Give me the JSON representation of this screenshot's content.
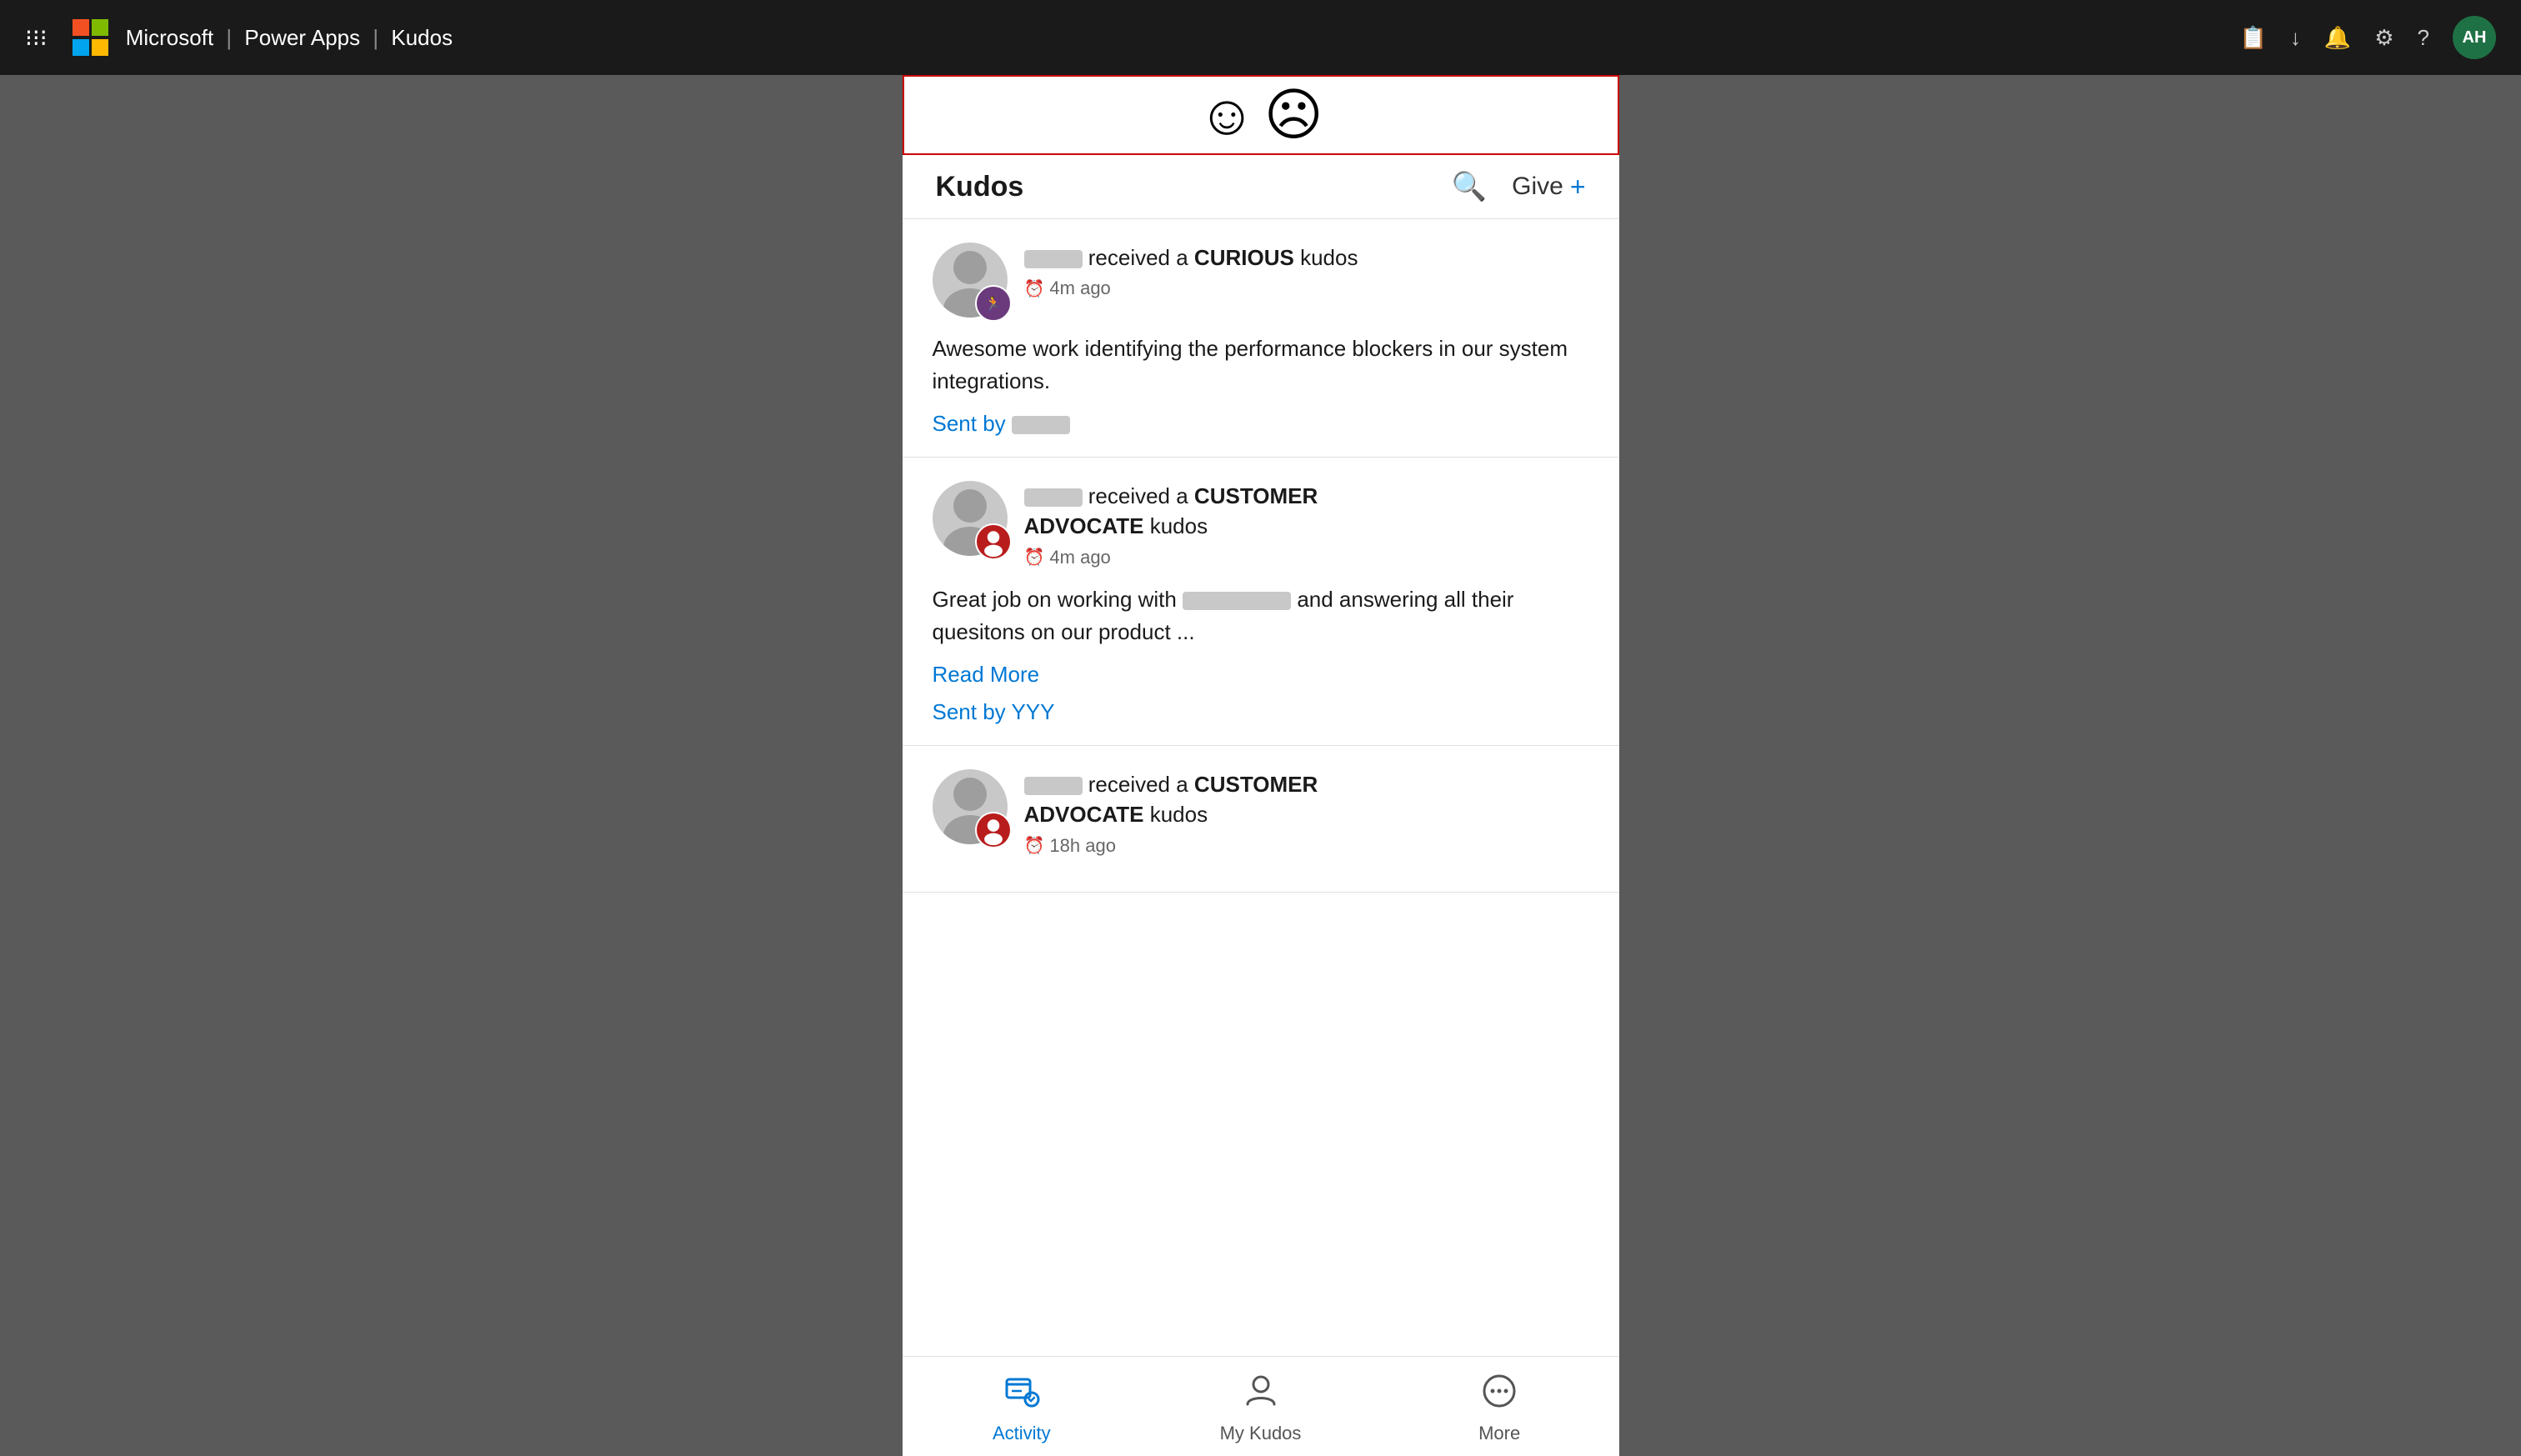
{
  "topbar": {
    "app_name": "Power Apps",
    "separator": "|",
    "app_section": "Kudos",
    "icons": {
      "waffle": "⊞",
      "share": "🗐",
      "download": "⬇",
      "bell": "🔔",
      "settings": "⚙",
      "help": "?"
    },
    "avatar_initials": "AH"
  },
  "app": {
    "header_title": "Kudos",
    "emoji_happy": "☺",
    "emoji_sad": "☹",
    "give_label": "Give",
    "give_plus": "+",
    "feed": [
      {
        "id": 1,
        "recipient_blurred": true,
        "received_text": "received a",
        "kudos_type": "CURIOUS",
        "kudos_suffix": "kudos",
        "time": "4m ago",
        "badge_color": "purple",
        "badge_icon": "🏃",
        "message": "Awesome work identifying the performance blockers in our system integrations.",
        "sent_by_label": "Sent by",
        "sender_blurred": true,
        "has_read_more": false
      },
      {
        "id": 2,
        "recipient_blurred": true,
        "received_text": "received a",
        "kudos_type": "CUSTOMER ADVOCATE",
        "kudos_suffix": "kudos",
        "time": "4m ago",
        "badge_color": "red",
        "badge_icon": "👤",
        "message": "Great job on working with",
        "message_blurred_part": true,
        "message_suffix": "and answering all their quesitons on our product ...",
        "sent_by_label": "Sent by",
        "sender": "YYY",
        "has_read_more": true,
        "read_more_label": "Read More"
      },
      {
        "id": 3,
        "recipient_blurred": true,
        "received_text": "received a",
        "kudos_type": "CUSTOMER ADVOCATE",
        "kudos_suffix": "kudos",
        "time": "18h ago",
        "badge_color": "red",
        "badge_icon": "👤",
        "message": "",
        "has_read_more": false,
        "is_partial": true
      }
    ],
    "bottom_nav": [
      {
        "id": "activity",
        "label": "Activity",
        "icon": "activity",
        "active": true
      },
      {
        "id": "my-kudos",
        "label": "My Kudos",
        "icon": "person",
        "active": false
      },
      {
        "id": "more",
        "label": "More",
        "icon": "more",
        "active": false
      }
    ]
  }
}
